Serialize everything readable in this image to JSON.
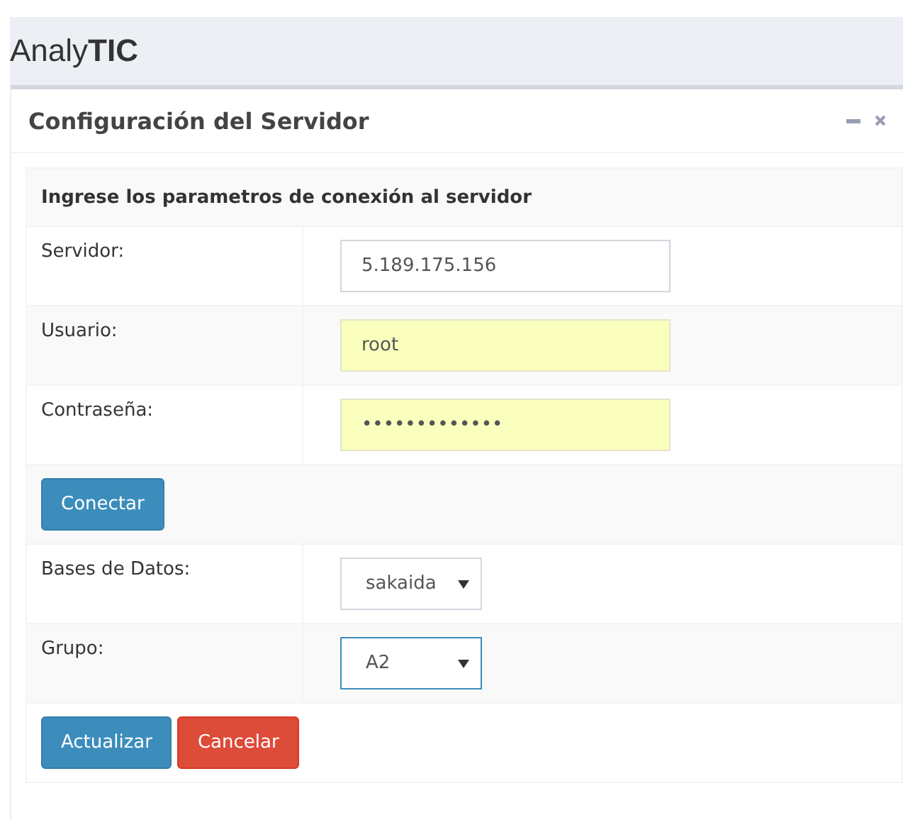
{
  "brand": {
    "light": "Analy",
    "bold": "TIC"
  },
  "panel": {
    "title": "Configuración del Servidor",
    "tools": [
      {
        "kind": "minimize"
      },
      {
        "kind": "close"
      }
    ],
    "heading": "Ingrese los parametros de conexión al servidor",
    "rows": [
      {
        "kind": "field",
        "label": "Servidor:",
        "input": {
          "kind": "text",
          "value": "5.189.175.156",
          "autofilled": false,
          "focused": false
        }
      },
      {
        "kind": "field",
        "label": "Usuario:",
        "input": {
          "kind": "text",
          "value": "root",
          "autofilled": true,
          "focused": false
        }
      },
      {
        "kind": "field",
        "label": "Contraseña:",
        "input": {
          "kind": "password",
          "value": "•••••••••••••",
          "autofilled": true,
          "focused": false
        }
      },
      {
        "kind": "actions",
        "buttons": [
          {
            "label": "Conectar",
            "kind": "primary"
          }
        ]
      },
      {
        "kind": "field",
        "label": "Bases de Datos:",
        "input": {
          "kind": "select",
          "value": "sakaida",
          "autofilled": false,
          "focused": false
        }
      },
      {
        "kind": "field",
        "label": "Grupo:",
        "input": {
          "kind": "select",
          "value": "A2",
          "autofilled": false,
          "focused": true
        }
      },
      {
        "kind": "actions",
        "buttons": [
          {
            "label": "Actualizar",
            "kind": "primary"
          },
          {
            "label": "Cancelar",
            "kind": "danger"
          }
        ]
      }
    ]
  }
}
